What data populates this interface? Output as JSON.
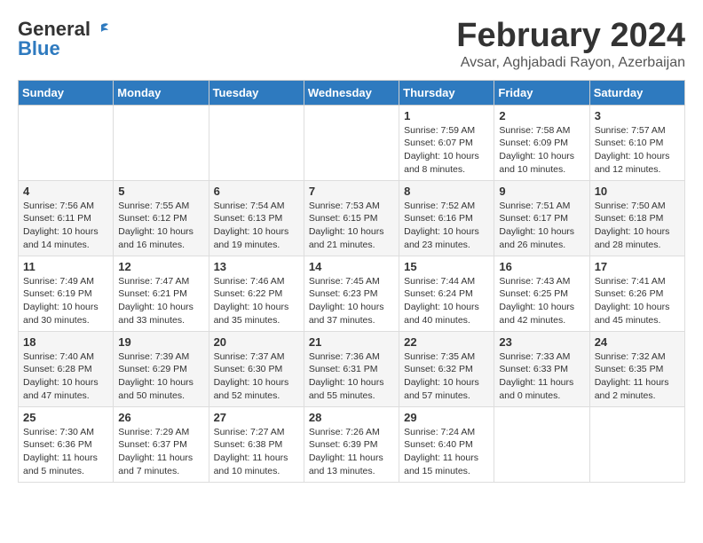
{
  "header": {
    "logo_general": "General",
    "logo_blue": "Blue",
    "title": "February 2024",
    "subtitle": "Avsar, Aghjabadi Rayon, Azerbaijan"
  },
  "calendar": {
    "days_of_week": [
      "Sunday",
      "Monday",
      "Tuesday",
      "Wednesday",
      "Thursday",
      "Friday",
      "Saturday"
    ],
    "weeks": [
      [
        {
          "day": "",
          "info": ""
        },
        {
          "day": "",
          "info": ""
        },
        {
          "day": "",
          "info": ""
        },
        {
          "day": "",
          "info": ""
        },
        {
          "day": "1",
          "info": "Sunrise: 7:59 AM\nSunset: 6:07 PM\nDaylight: 10 hours\nand 8 minutes."
        },
        {
          "day": "2",
          "info": "Sunrise: 7:58 AM\nSunset: 6:09 PM\nDaylight: 10 hours\nand 10 minutes."
        },
        {
          "day": "3",
          "info": "Sunrise: 7:57 AM\nSunset: 6:10 PM\nDaylight: 10 hours\nand 12 minutes."
        }
      ],
      [
        {
          "day": "4",
          "info": "Sunrise: 7:56 AM\nSunset: 6:11 PM\nDaylight: 10 hours\nand 14 minutes."
        },
        {
          "day": "5",
          "info": "Sunrise: 7:55 AM\nSunset: 6:12 PM\nDaylight: 10 hours\nand 16 minutes."
        },
        {
          "day": "6",
          "info": "Sunrise: 7:54 AM\nSunset: 6:13 PM\nDaylight: 10 hours\nand 19 minutes."
        },
        {
          "day": "7",
          "info": "Sunrise: 7:53 AM\nSunset: 6:15 PM\nDaylight: 10 hours\nand 21 minutes."
        },
        {
          "day": "8",
          "info": "Sunrise: 7:52 AM\nSunset: 6:16 PM\nDaylight: 10 hours\nand 23 minutes."
        },
        {
          "day": "9",
          "info": "Sunrise: 7:51 AM\nSunset: 6:17 PM\nDaylight: 10 hours\nand 26 minutes."
        },
        {
          "day": "10",
          "info": "Sunrise: 7:50 AM\nSunset: 6:18 PM\nDaylight: 10 hours\nand 28 minutes."
        }
      ],
      [
        {
          "day": "11",
          "info": "Sunrise: 7:49 AM\nSunset: 6:19 PM\nDaylight: 10 hours\nand 30 minutes."
        },
        {
          "day": "12",
          "info": "Sunrise: 7:47 AM\nSunset: 6:21 PM\nDaylight: 10 hours\nand 33 minutes."
        },
        {
          "day": "13",
          "info": "Sunrise: 7:46 AM\nSunset: 6:22 PM\nDaylight: 10 hours\nand 35 minutes."
        },
        {
          "day": "14",
          "info": "Sunrise: 7:45 AM\nSunset: 6:23 PM\nDaylight: 10 hours\nand 37 minutes."
        },
        {
          "day": "15",
          "info": "Sunrise: 7:44 AM\nSunset: 6:24 PM\nDaylight: 10 hours\nand 40 minutes."
        },
        {
          "day": "16",
          "info": "Sunrise: 7:43 AM\nSunset: 6:25 PM\nDaylight: 10 hours\nand 42 minutes."
        },
        {
          "day": "17",
          "info": "Sunrise: 7:41 AM\nSunset: 6:26 PM\nDaylight: 10 hours\nand 45 minutes."
        }
      ],
      [
        {
          "day": "18",
          "info": "Sunrise: 7:40 AM\nSunset: 6:28 PM\nDaylight: 10 hours\nand 47 minutes."
        },
        {
          "day": "19",
          "info": "Sunrise: 7:39 AM\nSunset: 6:29 PM\nDaylight: 10 hours\nand 50 minutes."
        },
        {
          "day": "20",
          "info": "Sunrise: 7:37 AM\nSunset: 6:30 PM\nDaylight: 10 hours\nand 52 minutes."
        },
        {
          "day": "21",
          "info": "Sunrise: 7:36 AM\nSunset: 6:31 PM\nDaylight: 10 hours\nand 55 minutes."
        },
        {
          "day": "22",
          "info": "Sunrise: 7:35 AM\nSunset: 6:32 PM\nDaylight: 10 hours\nand 57 minutes."
        },
        {
          "day": "23",
          "info": "Sunrise: 7:33 AM\nSunset: 6:33 PM\nDaylight: 11 hours\nand 0 minutes."
        },
        {
          "day": "24",
          "info": "Sunrise: 7:32 AM\nSunset: 6:35 PM\nDaylight: 11 hours\nand 2 minutes."
        }
      ],
      [
        {
          "day": "25",
          "info": "Sunrise: 7:30 AM\nSunset: 6:36 PM\nDaylight: 11 hours\nand 5 minutes."
        },
        {
          "day": "26",
          "info": "Sunrise: 7:29 AM\nSunset: 6:37 PM\nDaylight: 11 hours\nand 7 minutes."
        },
        {
          "day": "27",
          "info": "Sunrise: 7:27 AM\nSunset: 6:38 PM\nDaylight: 11 hours\nand 10 minutes."
        },
        {
          "day": "28",
          "info": "Sunrise: 7:26 AM\nSunset: 6:39 PM\nDaylight: 11 hours\nand 13 minutes."
        },
        {
          "day": "29",
          "info": "Sunrise: 7:24 AM\nSunset: 6:40 PM\nDaylight: 11 hours\nand 15 minutes."
        },
        {
          "day": "",
          "info": ""
        },
        {
          "day": "",
          "info": ""
        }
      ]
    ]
  }
}
